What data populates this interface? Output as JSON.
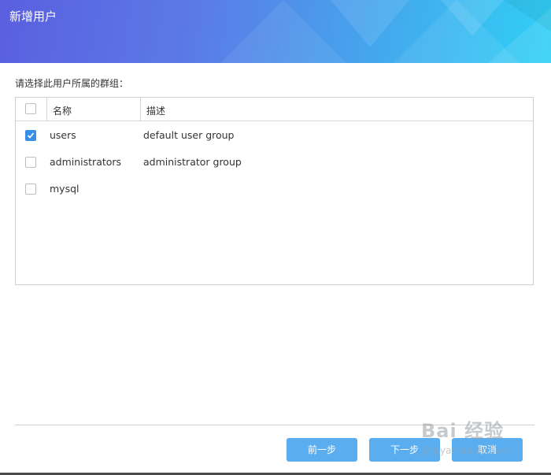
{
  "dialog": {
    "title": "新增用户",
    "prompt": "请选择此用户所属的群组："
  },
  "table": {
    "columns": [
      "名称",
      "描述"
    ],
    "rows": [
      {
        "name": "users",
        "description": "default user group",
        "checked": true
      },
      {
        "name": "administrators",
        "description": "administrator group",
        "checked": false
      },
      {
        "name": "mysql",
        "description": "",
        "checked": false
      }
    ]
  },
  "buttons": {
    "prev": "前一步",
    "next": "下一步",
    "cancel": "取消"
  },
  "watermark": {
    "text": "Bai 经验",
    "sub": "jingyan.baidu.com"
  },
  "colors": {
    "accent": "#3a8ee6",
    "button": "#5aaef0",
    "header_start": "#5a5fe0",
    "header_end": "#2fd0f5"
  }
}
